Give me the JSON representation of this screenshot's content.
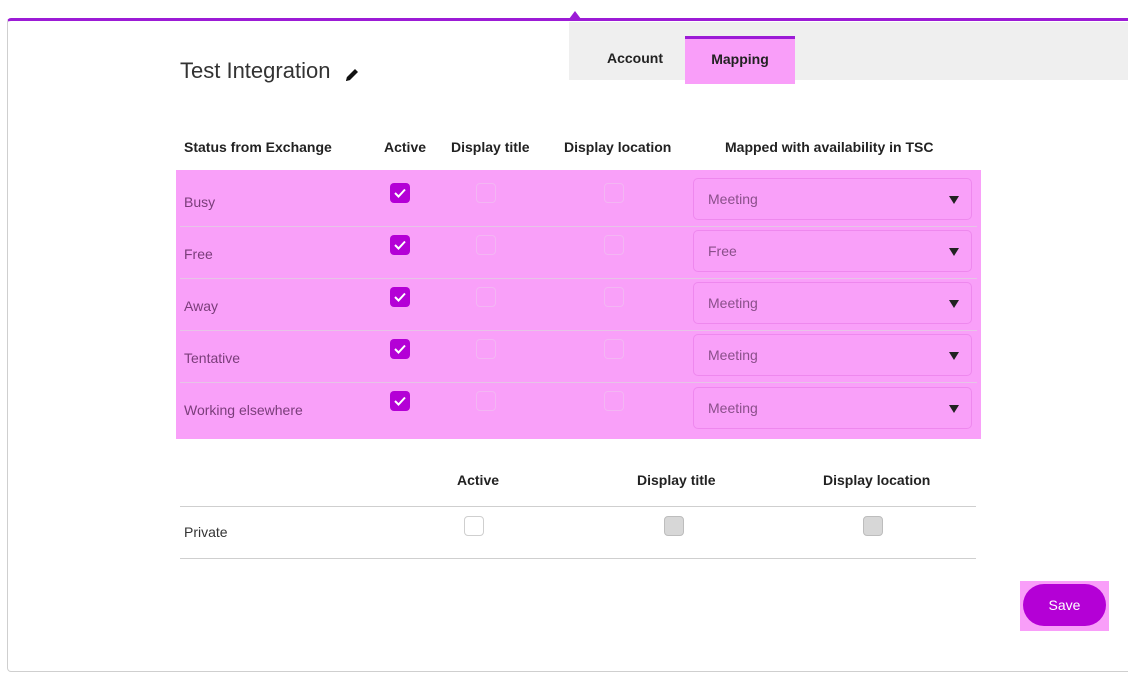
{
  "header": {
    "title": "Test Integration",
    "edit_icon": "pencil-icon"
  },
  "tabs": [
    {
      "label": "Account"
    },
    {
      "label": "Mapping"
    }
  ],
  "table": {
    "headers": {
      "status": "Status from Exchange",
      "active": "Active",
      "display_title": "Display title",
      "display_location": "Display location",
      "mapped": "Mapped with availability in TSC"
    },
    "rows": [
      {
        "status": "Busy",
        "active": true,
        "display_title": false,
        "display_location": false,
        "mapped": "Meeting"
      },
      {
        "status": "Free",
        "active": true,
        "display_title": false,
        "display_location": false,
        "mapped": "Free"
      },
      {
        "status": "Away",
        "active": true,
        "display_title": false,
        "display_location": false,
        "mapped": "Meeting"
      },
      {
        "status": "Tentative",
        "active": true,
        "display_title": false,
        "display_location": false,
        "mapped": "Meeting"
      },
      {
        "status": "Working elsewhere",
        "active": true,
        "display_title": false,
        "display_location": false,
        "mapped": "Meeting"
      }
    ]
  },
  "private_section": {
    "headers": {
      "active": "Active",
      "display_title": "Display title",
      "display_location": "Display location"
    },
    "row": {
      "label": "Private",
      "active": false,
      "display_title": false,
      "display_location": false
    }
  },
  "save_label": "Save",
  "colors": {
    "accent": "#b400d6",
    "highlight": "#f9a0f9",
    "top_border": "#9c1bd6"
  }
}
